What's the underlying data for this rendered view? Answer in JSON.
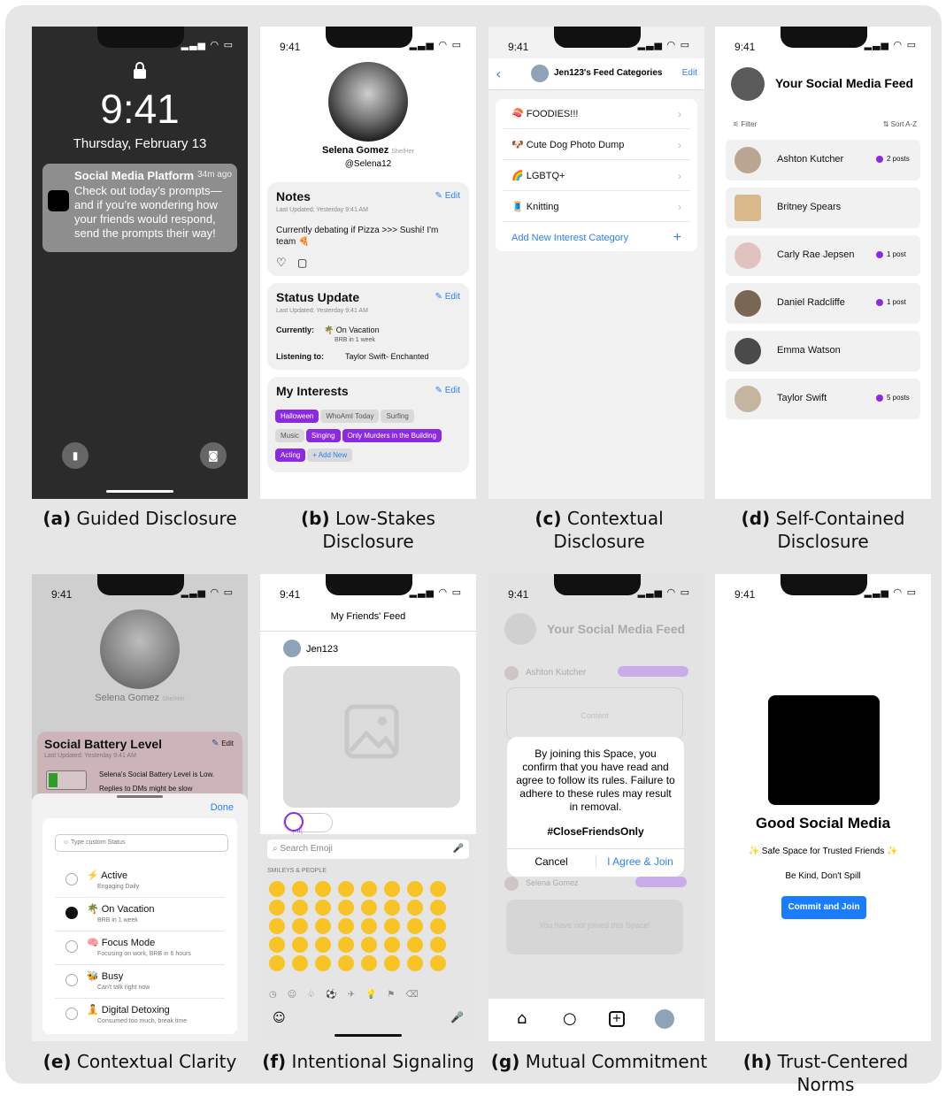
{
  "time": "9:41",
  "captions": [
    {
      "letter": "(a)",
      "text": " Guided Disclosure"
    },
    {
      "letter": "(b)",
      "text": " Low-Stakes Disclosure"
    },
    {
      "letter": "(c)",
      "text": " Contextual Disclosure"
    },
    {
      "letter": "(d)",
      "text": " Self-Contained Disclosure"
    },
    {
      "letter": "(e)",
      "text": " Contextual Clarity"
    },
    {
      "letter": "(f)",
      "text": " Intentional Signaling"
    },
    {
      "letter": "(g)",
      "text": " Mutual Commitment"
    },
    {
      "letter": "(h)",
      "text": " Trust-Centered Norms"
    }
  ],
  "a": {
    "clock": "9:41",
    "date": "Thursday, February 13",
    "notif_title": "Social Media Platform",
    "notif_time": "34m ago",
    "notif_body": "Check out today’s prompts—and if you’re wondering how your friends would respond, send the prompts their way!"
  },
  "b": {
    "name": "Selena Gomez",
    "pronouns": "She/Her",
    "handle": "@Selena12",
    "notes_title": "Notes",
    "edit": "Edit",
    "updated": "Last Updated: Yesterday 9:41 AM",
    "notes_body": "Currently debating if Pizza >>> Sushi! I'm team 🍕",
    "status_title": "Status Update",
    "currently_label": "Currently:",
    "currently": "🌴 On Vacation",
    "currently_sub": "BRB in 1 week",
    "listening_label": "Listening to:",
    "listening": "Taylor Swift- Enchanted",
    "interests_title": "My Interests",
    "chips": [
      "Halloween",
      "WhoAmI Today",
      "Surfing",
      "Music",
      "Singing",
      "Only Murders in the Building",
      "Acting",
      "+ Add New"
    ]
  },
  "c": {
    "title": "Jen123's Feed Categories",
    "edit": "Edit",
    "rows": [
      "🍣 FOODIES!!!",
      "🐶 Cute Dog Photo Dump",
      "🌈 LGBTQ+",
      "🧵 Knitting"
    ],
    "add": "Add New Interest Category"
  },
  "d": {
    "title": "Your Social Media Feed",
    "filter": "Filter",
    "sort": "Sort A-Z",
    "rows": [
      {
        "name": "Ashton Kutcher",
        "posts": "2 posts"
      },
      {
        "name": "Britney Spears",
        "posts": ""
      },
      {
        "name": "Carly Rae Jepsen",
        "posts": "1 post"
      },
      {
        "name": "Daniel Radcliffe",
        "posts": "1 post"
      },
      {
        "name": "Emma Watson",
        "posts": ""
      },
      {
        "name": "Taylor Swift",
        "posts": "5 posts"
      }
    ]
  },
  "e": {
    "name": "Selena Gomez",
    "pronouns": "She/Her",
    "battery_title": "Social Battery Level",
    "edit": "Edit",
    "updated": "Last Updated: Yesterday 9:41 AM",
    "battery_text": "Selena's Social Battery Level is Low.",
    "battery_sub": "Replies to DMs might be slow",
    "done": "Done",
    "custom_placeholder": "Type custom Status",
    "options": [
      {
        "label": "⚡ Active",
        "sub": "Engaging Daily"
      },
      {
        "label": "🌴 On Vacation",
        "sub": "BRB in 1 week"
      },
      {
        "label": "🧠 Focus Mode",
        "sub": "Focusing on work, BRB in 6 hours"
      },
      {
        "label": "🐝 Busy",
        "sub": "Can't talk right now"
      },
      {
        "label": "🧘 Digital Detoxing",
        "sub": "Consumed too much, break time"
      }
    ]
  },
  "f": {
    "title": "My Friends' Feed",
    "user": "Jen123",
    "search": "Search Emoji",
    "section": "SMILEYS & PEOPLE"
  },
  "g": {
    "title": "Your Social Media Feed",
    "row1": "Ashton Kutcher",
    "content": "Content",
    "row2": "Selena Gomez",
    "dialog": "By joining this Space, you confirm that you have read and agree to follow its rules. Failure to adhere to these rules may result in removal.",
    "tag": "#CloseFriendsOnly",
    "cancel": "Cancel",
    "agree": "I Agree & Join",
    "notjoined": "You have not joined this Space!"
  },
  "h": {
    "title": "Good Social Media",
    "sub": "✨ Safe Space for Trusted Friends ✨",
    "motto": "Be Kind, Don't Spill",
    "button": "Commit and Join"
  }
}
